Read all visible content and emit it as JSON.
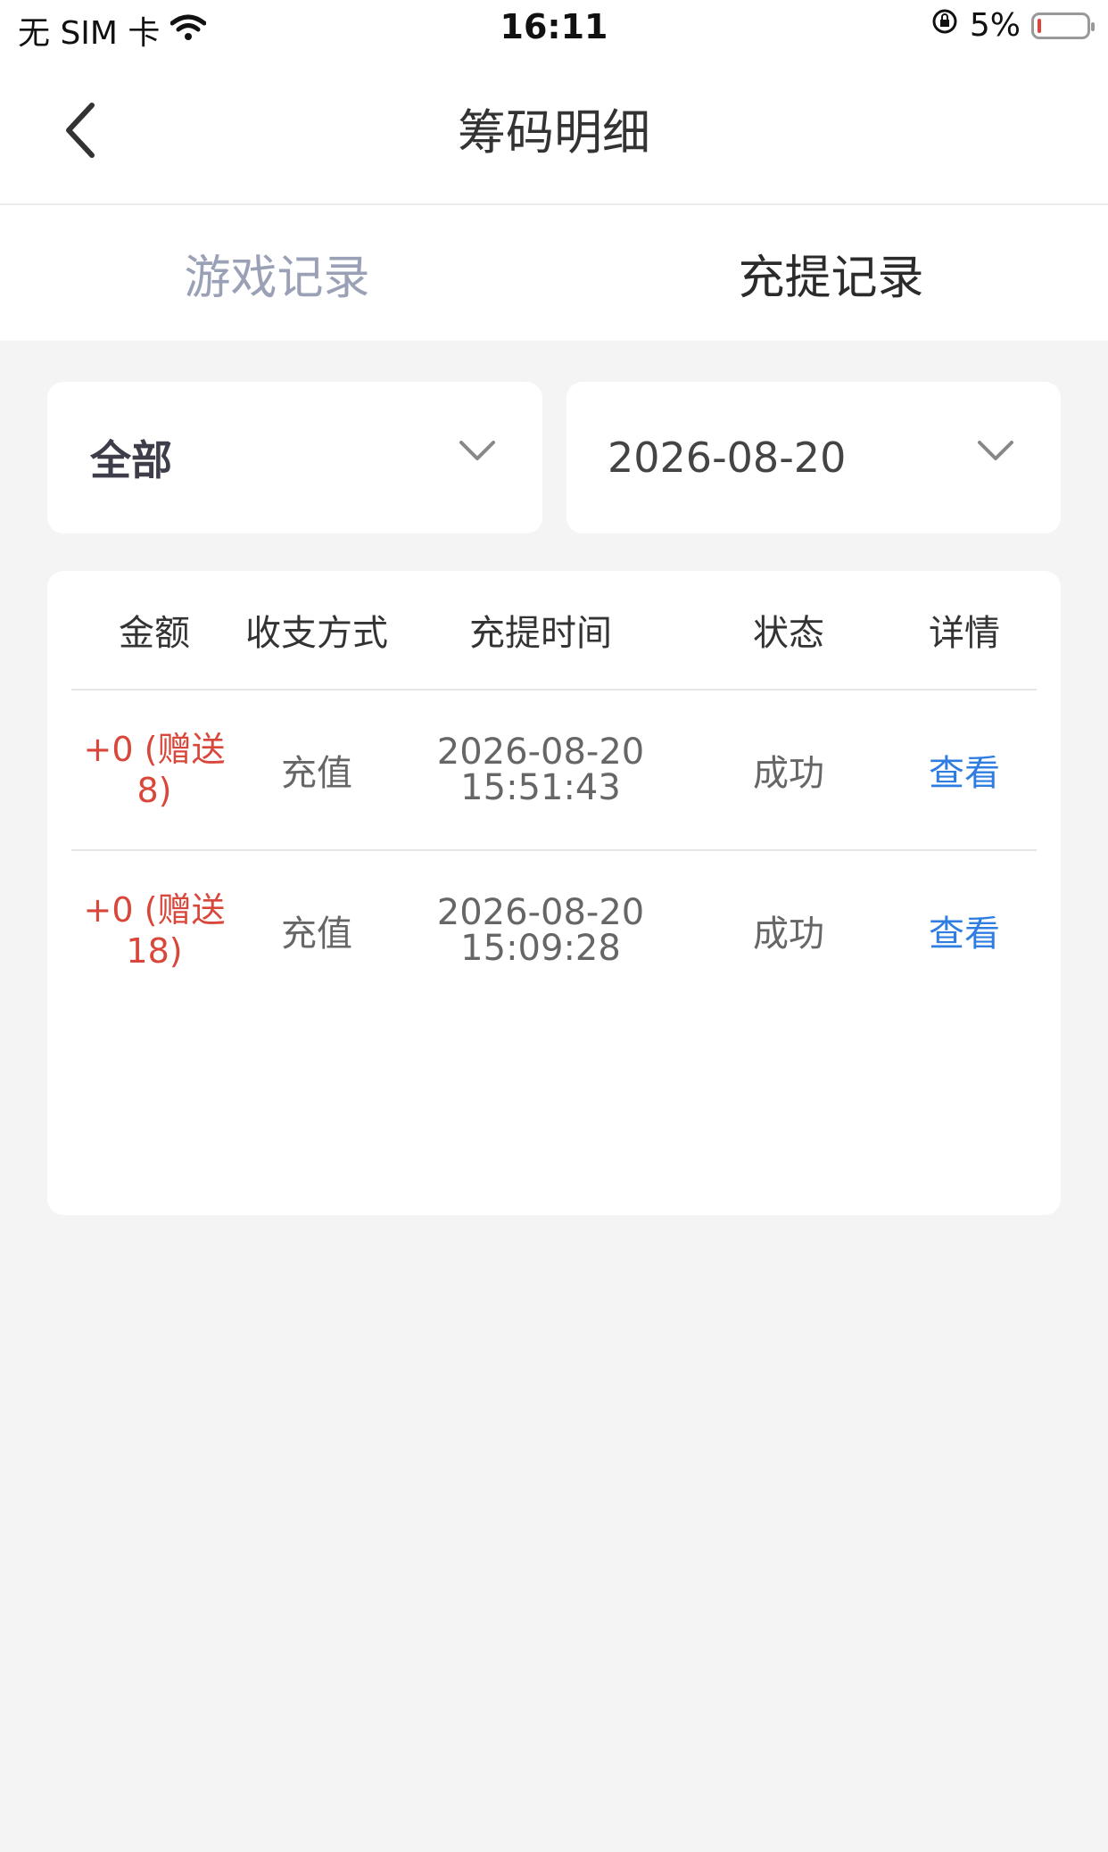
{
  "status_bar": {
    "carrier": "无 SIM 卡",
    "time": "16:11",
    "battery": "5%"
  },
  "nav": {
    "title": "筹码明细"
  },
  "tabs": [
    {
      "label": "游戏记录",
      "active": false
    },
    {
      "label": "充提记录",
      "active": true
    }
  ],
  "filters": {
    "type_value": "全部",
    "date_value": "2026-08-20"
  },
  "table": {
    "headers": [
      "金额",
      "收支方式",
      "充提时间",
      "状态",
      "详情"
    ],
    "rows": [
      {
        "amount_line1": "+0 (赠送",
        "amount_line2": "8)",
        "method": "充值",
        "date": "2026-08-20",
        "time": "15:51:43",
        "status": "成功",
        "detail": "查看"
      },
      {
        "amount_line1": "+0 (赠送",
        "amount_line2": "18)",
        "method": "充值",
        "date": "2026-08-20",
        "time": "15:09:28",
        "status": "成功",
        "detail": "查看"
      }
    ]
  },
  "colors": {
    "amount": "#d9473b",
    "link": "#2f7de1",
    "inactive_tab": "#9aa0b6",
    "background": "#f4f4f5"
  }
}
